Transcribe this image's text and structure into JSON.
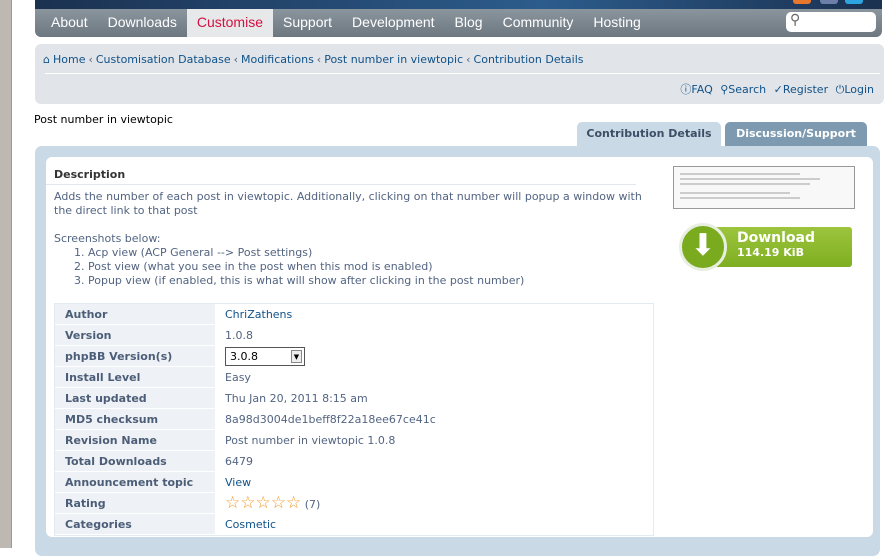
{
  "nav": {
    "items": [
      "About",
      "Downloads",
      "Customise",
      "Support",
      "Development",
      "Blog",
      "Community",
      "Hosting"
    ],
    "active": "Customise",
    "search_placeholder": ""
  },
  "breadcrumb": [
    "Home",
    "Customisation Database",
    "Modifications",
    "Post number in viewtopic",
    "Contribution Details"
  ],
  "user_links": {
    "faq": "FAQ",
    "search": "Search",
    "register": "Register",
    "login": "Login"
  },
  "page_title": "Post number in viewtopic",
  "tabs": [
    "Contribution Details",
    "Discussion/Support"
  ],
  "description": {
    "heading": "Description",
    "text": "Adds the number of each post in viewtopic. Additionally, clicking on that number will popup a window with the direct link to that post",
    "screenshots_label": "Screenshots below:",
    "items": [
      "Acp view (ACP General --> Post settings)",
      "Post view (what you see in the post when this mod is enabled)",
      "Popup view (if enabled, this is what will show after clicking in the post number)"
    ]
  },
  "download": {
    "label": "Download",
    "size": "114.19 KiB",
    "color": "#8dbb2e"
  },
  "details": {
    "author": {
      "label": "Author",
      "value": "ChriZathens"
    },
    "version": {
      "label": "Version",
      "value": "1.0.8"
    },
    "phpbb": {
      "label": "phpBB Version(s)",
      "value": "3.0.8"
    },
    "install": {
      "label": "Install Level",
      "value": "Easy"
    },
    "updated": {
      "label": "Last updated",
      "value": "Thu Jan 20, 2011 8:15 am"
    },
    "md5": {
      "label": "MD5 checksum",
      "value": "8a98d3004de1beff8f22a18ee67ce41c"
    },
    "revision": {
      "label": "Revision Name",
      "value": "Post number in viewtopic 1.0.8"
    },
    "downloads": {
      "label": "Total Downloads",
      "value": "6479"
    },
    "announcement": {
      "label": "Announcement topic",
      "value": "View"
    },
    "rating": {
      "label": "Rating",
      "stars_filled": 0,
      "stars_total": 5,
      "count": "(7)"
    },
    "categories": {
      "label": "Categories",
      "value": "Cosmetic"
    }
  }
}
